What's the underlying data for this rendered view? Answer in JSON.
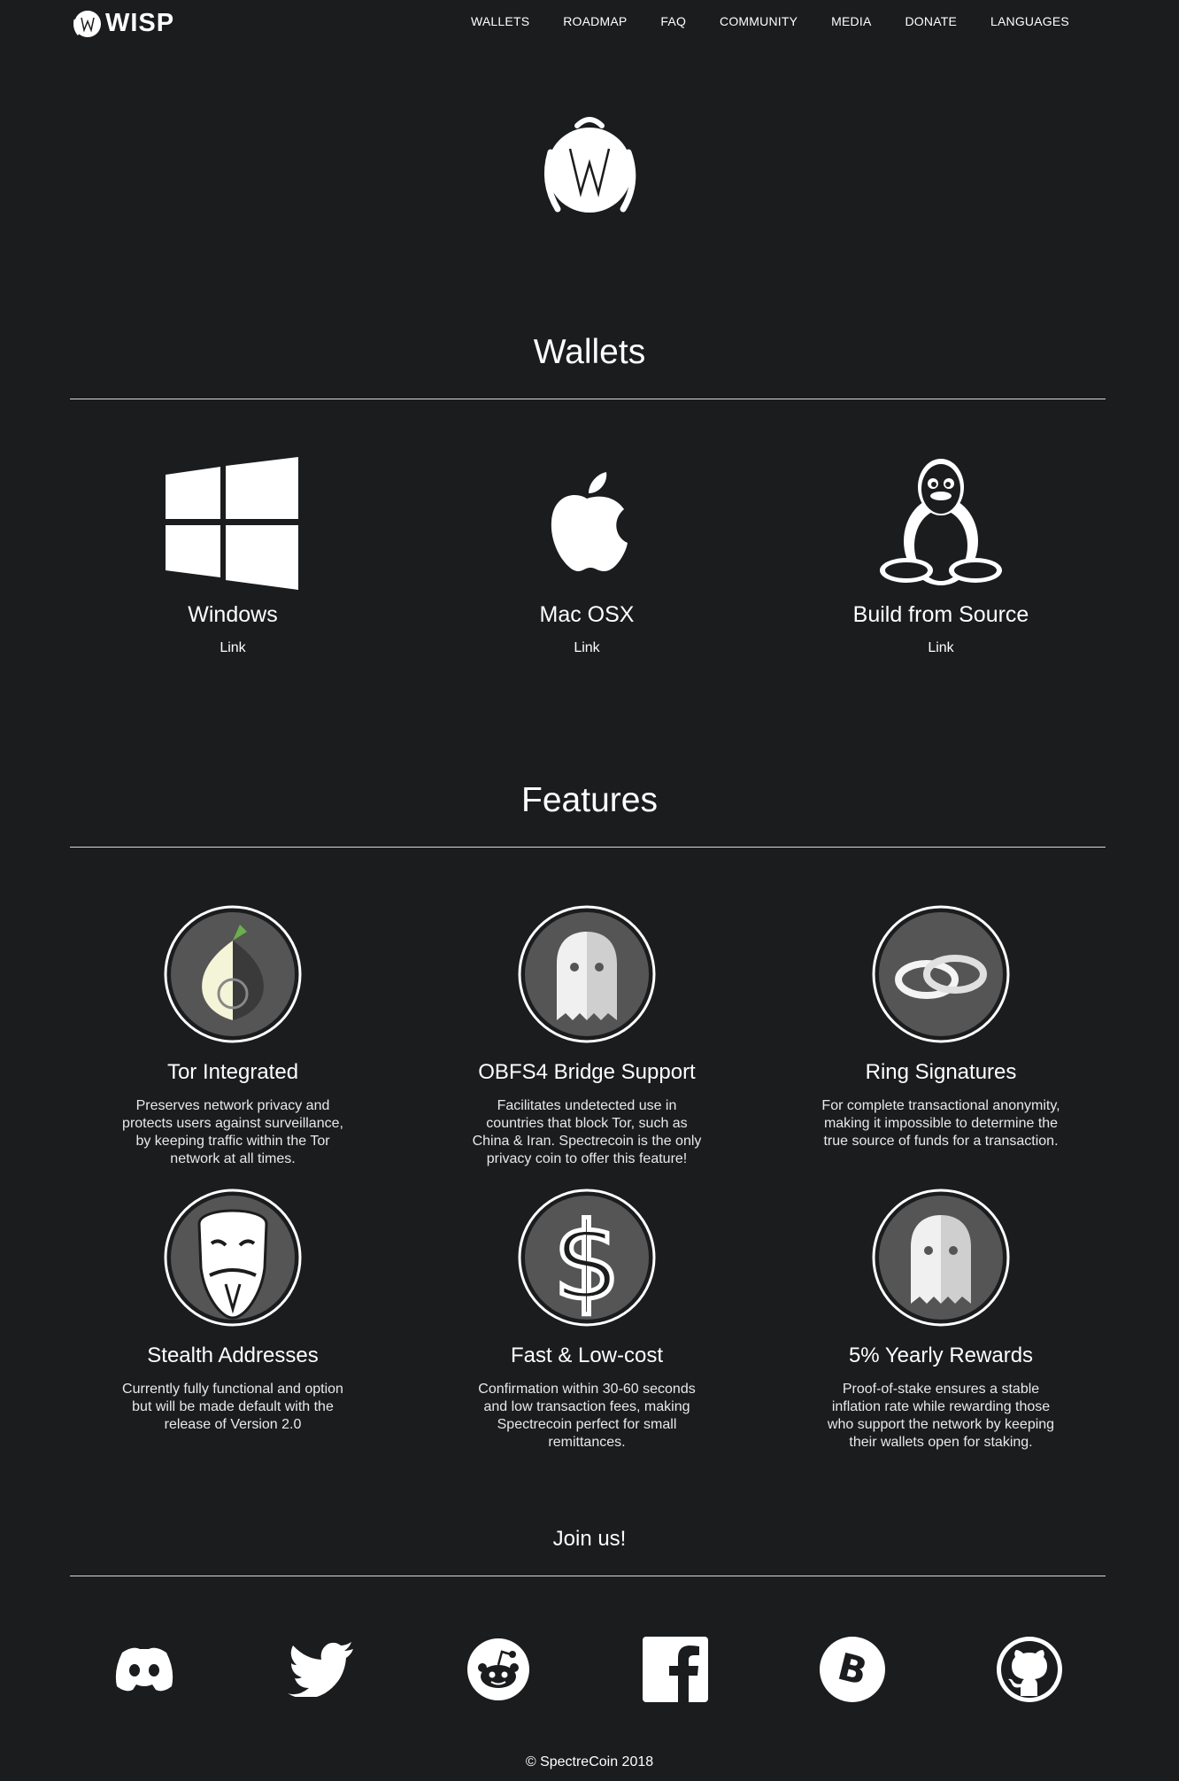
{
  "nav": {
    "brand": "WISP",
    "items": [
      "WALLETS",
      "ROADMAP",
      "FAQ",
      "COMMUNITY",
      "MEDIA",
      "DONATE",
      "LANGUAGES"
    ]
  },
  "wallets": {
    "title": "Wallets",
    "items": [
      {
        "name": "Windows",
        "link": "Link",
        "icon": "windows-icon"
      },
      {
        "name": "Mac OSX",
        "link": "Link",
        "icon": "apple-icon"
      },
      {
        "name": "Build from Source",
        "link": "Link",
        "icon": "linux-penguin-icon"
      }
    ]
  },
  "features": {
    "title": "Features",
    "items": [
      {
        "title": "Tor Integrated",
        "desc": "Preserves network privacy and protects users against surveillance, by keeping traffic within the Tor network at all times.",
        "icon": "tor-onion-icon"
      },
      {
        "title": "OBFS4 Bridge Support",
        "desc": "Facilitates undetected use in countries that block Tor, such as China & Iran. Spectrecoin is the only privacy coin to offer this feature!",
        "icon": "ghost-icon"
      },
      {
        "title": "Ring Signatures",
        "desc": "For complete transactional anonymity, making it impossible to determine the true source of funds for a transaction.",
        "icon": "rings-icon"
      },
      {
        "title": "Stealth Addresses",
        "desc": "Currently fully functional and option but will be made default with the release of Version 2.0",
        "icon": "anonymous-mask-icon"
      },
      {
        "title": "Fast & Low-cost",
        "desc": "Confirmation within 30-60 seconds and low transaction fees, making Spectrecoin perfect for small remittances.",
        "icon": "dollar-icon"
      },
      {
        "title": "5% Yearly Rewards",
        "desc": "Proof-of-stake ensures a stable inflation rate while rewarding those who support the network by keeping their wallets open for staking.",
        "icon": "ghost-icon"
      }
    ]
  },
  "join": {
    "title": "Join us!",
    "social": [
      "discord-icon",
      "twitter-icon",
      "reddit-icon",
      "facebook-icon",
      "bitcoin-icon",
      "github-icon"
    ]
  },
  "footer": {
    "copyright": "© SpectreCoin 2018"
  },
  "colors": {
    "background": "#1b1c1e",
    "text": "#ffffff",
    "icon_circle": "#555555"
  }
}
